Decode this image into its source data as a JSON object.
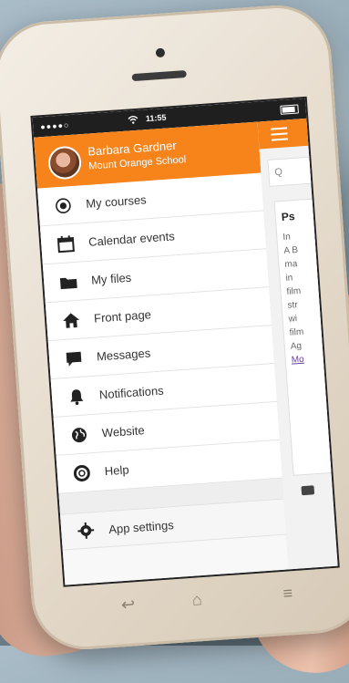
{
  "status": {
    "carrier": "●●●●○",
    "time": "11:55"
  },
  "user": {
    "name": "Barbara Gardner",
    "school": "Mount Orange School"
  },
  "menu": [
    {
      "label": "My courses",
      "icon": "target-icon"
    },
    {
      "label": "Calendar events",
      "icon": "calendar-icon"
    },
    {
      "label": "My files",
      "icon": "folder-icon"
    },
    {
      "label": "Front page",
      "icon": "home-icon"
    },
    {
      "label": "Messages",
      "icon": "chat-icon"
    },
    {
      "label": "Notifications",
      "icon": "bell-icon"
    },
    {
      "label": "Website",
      "icon": "globe-icon"
    },
    {
      "label": "Help",
      "icon": "lifebuoy-icon"
    },
    {
      "label": "App settings",
      "icon": "gear-icon"
    }
  ],
  "main": {
    "search_placeholder": "Q",
    "card_title": "Ps",
    "card_lines": [
      "In",
      "A B",
      "ma",
      "in",
      "film",
      "str",
      "wi",
      "film",
      "Ag"
    ],
    "card_link": "Mo"
  },
  "colors": {
    "accent": "#f7831b"
  }
}
